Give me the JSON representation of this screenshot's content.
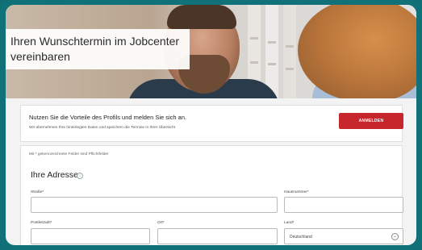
{
  "hero": {
    "title": "Ihren Wunschtermin im Jobcenter vereinbaren"
  },
  "login_panel": {
    "title": "Nutzen Sie die Vorteile des Profils und melden Sie sich an.",
    "subtitle": "Wir übernehmen Ihre hinterlegten Daten und speichern die Termine in Ihrer Übersicht",
    "button_label": "ANMELDEN"
  },
  "form": {
    "required_note": "Mit * gekennzeichnete Felder sind Pflichtfelder",
    "section_title": "Ihre Adresse",
    "fields": {
      "street_label": "Straße*",
      "street_value": "",
      "house_number_label": "Hausnummer*",
      "house_number_value": "",
      "zip_label": "Postleitzahl*",
      "zip_value": "",
      "city_label": "Ort*",
      "city_value": "",
      "country_label": "Land*",
      "country_value": "Deutschland"
    }
  },
  "colors": {
    "accent": "#c8262d",
    "frame": "#107178"
  },
  "icons": [
    "info-icon",
    "chevron-down-icon"
  ]
}
